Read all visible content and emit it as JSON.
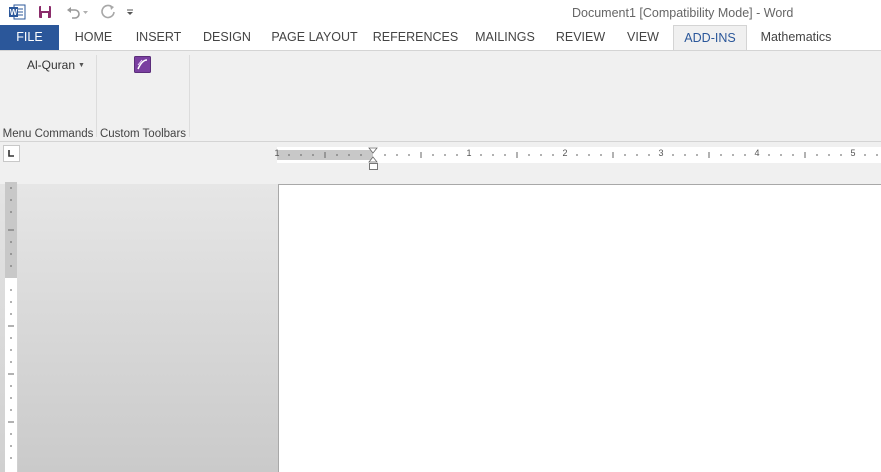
{
  "window": {
    "title": "Document1 [Compatibility Mode] - Word"
  },
  "quick_access": {
    "icons": [
      "word-logo-icon",
      "save-icon",
      "undo-icon",
      "redo-icon",
      "customize-qat-icon"
    ]
  },
  "tabs": [
    {
      "label": "FILE"
    },
    {
      "label": "HOME"
    },
    {
      "label": "INSERT"
    },
    {
      "label": "DESIGN"
    },
    {
      "label": "PAGE LAYOUT"
    },
    {
      "label": "REFERENCES"
    },
    {
      "label": "MAILINGS"
    },
    {
      "label": "REVIEW"
    },
    {
      "label": "VIEW"
    },
    {
      "label": "ADD-INS"
    },
    {
      "label": "Mathematics"
    }
  ],
  "ribbon": {
    "menu_commands": {
      "dropdown_label": "Al-Quran",
      "group_label": "Menu Commands"
    },
    "custom_toolbars": {
      "group_label": "Custom Toolbars"
    }
  },
  "ruler": {
    "numbers": [
      "1",
      "1",
      "2",
      "3",
      "4",
      "5"
    ]
  },
  "colors": {
    "accent": "#2b579a",
    "ribbon_bg": "#f0f0f0",
    "workspace_bg": "#d4d4d4"
  }
}
